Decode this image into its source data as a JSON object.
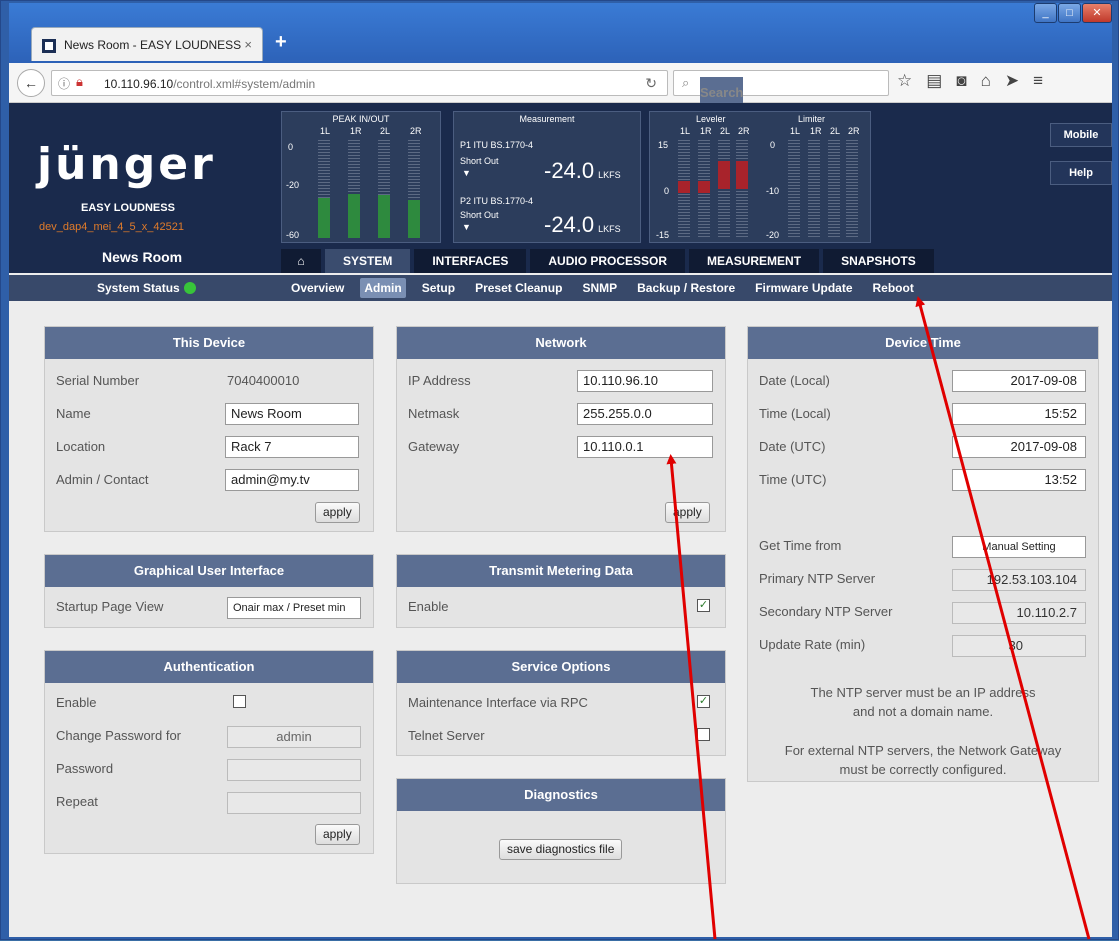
{
  "browser": {
    "tab_title": "News Room - EASY LOUDNESS",
    "tab_close": "×",
    "new_tab": "+",
    "url_host": "10.110.96.10",
    "url_path": "/control.xml#system/admin",
    "search_placeholder": "Search",
    "icons": [
      "back-icon",
      "info-icon",
      "insecure-icon",
      "reload-icon",
      "search-icon",
      "bookmark-star-icon",
      "reader-icon",
      "pocket-icon",
      "home-icon",
      "send-icon",
      "menu-icon"
    ]
  },
  "header": {
    "logo": "jünger",
    "product": "EASY LOUDNESS",
    "version": "dev_dap4_mei_4_5_x_42521",
    "device_name": "News Room",
    "side_buttons": [
      "Mobile",
      "Help"
    ]
  },
  "meters": {
    "peak": {
      "title": "PEAK IN/OUT",
      "channels": [
        "1L",
        "1R",
        "2L",
        "2R"
      ],
      "scale": [
        "0",
        "-20",
        "-60"
      ],
      "levels": [
        0.55,
        0.6,
        0.58,
        0.52
      ]
    },
    "measurement": {
      "title": "Measurement",
      "p1_label": "P1 ITU BS.1770-4",
      "p1_mode": "Short Out",
      "p1_value": "-24.0",
      "p1_unit": "LKFS",
      "p2_label": "P2 ITU BS.1770-4",
      "p2_mode": "Short Out",
      "p2_value": "-24.0",
      "p2_unit": "LKFS",
      "dropdown": "▼"
    },
    "leveler": {
      "title": "Leveler",
      "channels": [
        "1L",
        "1R",
        "2L",
        "2R"
      ],
      "scale": [
        "15",
        "0",
        "-15"
      ]
    },
    "limiter": {
      "title": "Limiter",
      "channels": [
        "1L",
        "1R",
        "2L",
        "2R"
      ],
      "scale": [
        "0",
        "-10",
        "-20"
      ]
    }
  },
  "main_tabs": [
    "SYSTEM",
    "INTERFACES",
    "AUDIO PROCESSOR",
    "MEASUREMENT",
    "SNAPSHOTS"
  ],
  "home_tab_icon": "home-icon",
  "subnav": {
    "status": "System Status",
    "links": [
      "Overview",
      "Admin",
      "Setup",
      "Preset Cleanup",
      "SNMP",
      "Backup / Restore",
      "Firmware Update",
      "Reboot"
    ],
    "active": "Admin"
  },
  "this_device": {
    "title": "This Device",
    "serial_label": "Serial Number",
    "serial": "7040400010",
    "name_label": "Name",
    "name": "News Room",
    "location_label": "Location",
    "location": "Rack 7",
    "contact_label": "Admin / Contact",
    "contact": "admin@my.tv",
    "apply": "apply"
  },
  "gui": {
    "title": "Graphical User Interface",
    "startup_label": "Startup Page View",
    "startup": "Onair max / Preset min"
  },
  "auth": {
    "title": "Authentication",
    "enable_label": "Enable",
    "change_label": "Change Password for",
    "change_user": "admin",
    "password_label": "Password",
    "repeat_label": "Repeat",
    "apply": "apply"
  },
  "network": {
    "title": "Network",
    "ip_label": "IP Address",
    "ip": "10.110.96.10",
    "mask_label": "Netmask",
    "mask": "255.255.0.0",
    "gw_label": "Gateway",
    "gw": "10.110.0.1",
    "apply": "apply"
  },
  "transmit": {
    "title": "Transmit Metering Data",
    "enable_label": "Enable",
    "enabled": true
  },
  "service": {
    "title": "Service Options",
    "rpc_label": "Maintenance Interface via RPC",
    "rpc": true,
    "telnet_label": "Telnet Server",
    "telnet": false
  },
  "diagnostics": {
    "title": "Diagnostics",
    "button": "save diagnostics file"
  },
  "device_time": {
    "title": "Device Time",
    "date_local_label": "Date (Local)",
    "date_local": "2017-09-08",
    "time_local_label": "Time (Local)",
    "time_local": "15:52",
    "date_utc_label": "Date (UTC)",
    "date_utc": "2017-09-08",
    "time_utc_label": "Time (UTC)",
    "time_utc": "13:52",
    "source_label": "Get Time from",
    "source": "Manual Setting",
    "ntp1_label": "Primary NTP Server",
    "ntp1": "192.53.103.104",
    "ntp2_label": "Secondary NTP Server",
    "ntp2": "10.110.2.7",
    "rate_label": "Update Rate (min)",
    "rate": "30",
    "note1a": "The NTP server must be an IP address",
    "note1b": "and not a domain name.",
    "note2a": "For external NTP servers, the Network Gateway",
    "note2b": "must be correctly configured."
  },
  "checkmark": "✓",
  "annotation_color": "#e00000"
}
